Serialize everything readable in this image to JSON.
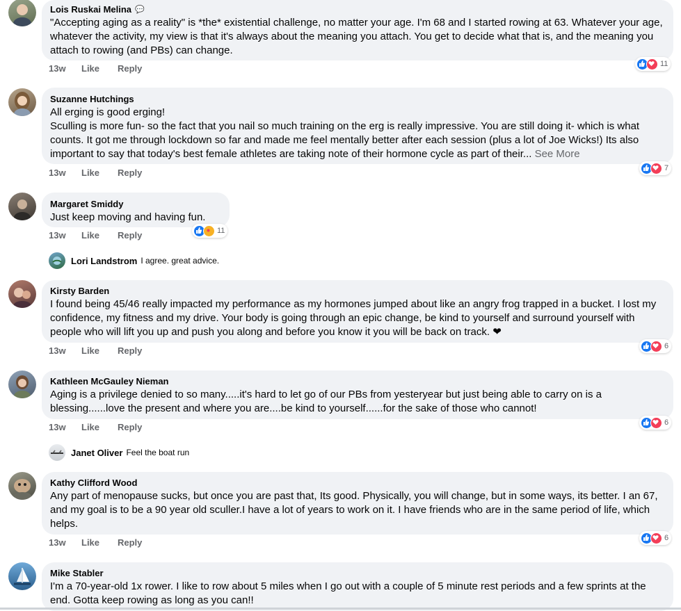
{
  "actions": {
    "like": "Like",
    "reply": "Reply"
  },
  "comments": [
    {
      "author": "Lois Ruskai Melina",
      "badge": "💬",
      "text": "\"Accepting aging as a reality\" is *the* existential challenge, no matter your age. I'm 68 and I started rowing at 63. Whatever your age, whatever the activity, my view is that it's always about the meaning you attach. You get to decide what that is, and the meaning you attach to rowing (and PBs) can change.",
      "time": "13w",
      "reactions": {
        "types": [
          "like",
          "love"
        ],
        "count": "11"
      }
    },
    {
      "author": "Suzanne Hutchings",
      "text": "All erging is good erging!",
      "text2": "Sculling is more fun- so the fact that you nail so much training on the erg is really impressive. You are still doing it- which is what counts. It got me through lockdown so far and made me feel mentally better after each session (plus a lot of Joe Wicks!) Its also important to say that today's best female athletes are taking note of their hormone cycle as part of their...",
      "see_more": "See More",
      "time": "13w",
      "reactions": {
        "types": [
          "like",
          "love"
        ],
        "count": "7"
      }
    },
    {
      "author": "Margaret Smiddy",
      "text": "Just keep moving and having fun.",
      "time": "13w",
      "reactions": {
        "types": [
          "like",
          "care"
        ],
        "count": "11"
      },
      "reply": {
        "author": "Lori Landstrom",
        "text": "I agree.  great advice."
      }
    },
    {
      "author": "Kirsty Barden",
      "text": "I found being 45/46 really impacted my performance as my hormones jumped about like an angry frog trapped in a bucket. I lost my confidence, my fitness and my drive. Your body is going through an epic change, be kind to yourself and surround yourself with people who will lift you up and push you along and before you know it you will be back on track. ❤",
      "time": "13w",
      "reactions": {
        "types": [
          "like",
          "love"
        ],
        "count": "6"
      }
    },
    {
      "author": "Kathleen McGauley Nieman",
      "text": "Aging is a privilege denied to so many.....it's hard to let go of our PBs from yesteryear but just being able to carry on is a blessing......love the present and where you are....be kind to yourself......for the sake of those who cannot!",
      "time": "13w",
      "reactions": {
        "types": [
          "like",
          "love"
        ],
        "count": "6"
      },
      "reply": {
        "author": "Janet Oliver",
        "text": "Feel the boat run"
      }
    },
    {
      "author": "Kathy Clifford Wood",
      "text": "Any part of menopause sucks, but once you are past that, Its good. Physically, you will change, but in some ways, its better. I an 67, and my goal is to be a 90 year old sculler.I have a lot of years to work on it. I have friends who are in the same period of life, which helps.",
      "time": "13w",
      "reactions": {
        "types": [
          "like",
          "love"
        ],
        "count": "6"
      }
    },
    {
      "author": "Mike Stabler",
      "text": "I'm a 70-year-old 1x rower. I like to row about 5 miles when I go out with a couple of 5 minute rest periods and a few sprints at the end. Gotta keep rowing as long as you can!!"
    }
  ]
}
